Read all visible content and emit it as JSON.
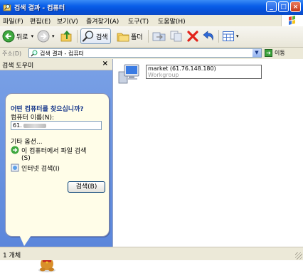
{
  "window": {
    "title": "검색 결과 - 컴퓨터",
    "controls": [
      "minimize",
      "maximize",
      "close"
    ]
  },
  "menu": {
    "items": [
      "파일(F)",
      "편집(E)",
      "보기(V)",
      "즐겨찾기(A)",
      "도구(T)",
      "도움말(H)"
    ]
  },
  "toolbar": {
    "back_label": "뒤로",
    "search_label": "검색",
    "folders_label": "폴더"
  },
  "address": {
    "label": "주소(D)",
    "value": "검색 결과 - 컴퓨터",
    "go_label": "이동"
  },
  "left_pane": {
    "title": "검색 도우미",
    "question": "어떤 컴퓨터를 찾으십니까?",
    "name_label": "컴퓨터 이름(N):",
    "name_value": "61.",
    "other_options": "기타 옵션...",
    "links": [
      {
        "label": "이 컴퓨터에서 파일 검색",
        "sub": "(S)"
      },
      {
        "label": "인터넷 검색(I)",
        "sub": ""
      }
    ],
    "search_button": "검색(B)"
  },
  "results": [
    {
      "name": "market (61.76.148.180)",
      "workgroup": "Workgroup"
    }
  ],
  "status": {
    "text": "1 개체"
  },
  "colors": {
    "title_bar": "#0a5ee8",
    "left_pane": "#6e95e3",
    "close_button": "#c5391a"
  }
}
